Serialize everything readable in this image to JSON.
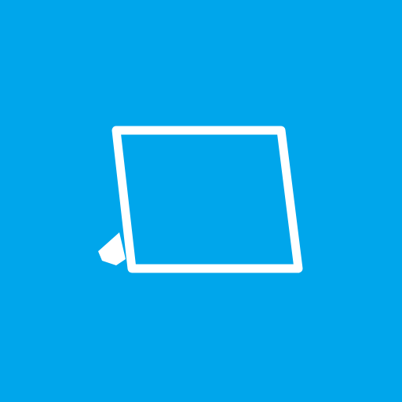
{
  "tile": {
    "background_color": "#00a6eb",
    "icon_color": "#ffffff",
    "icon": "tablet-with-kickstand-icon"
  }
}
